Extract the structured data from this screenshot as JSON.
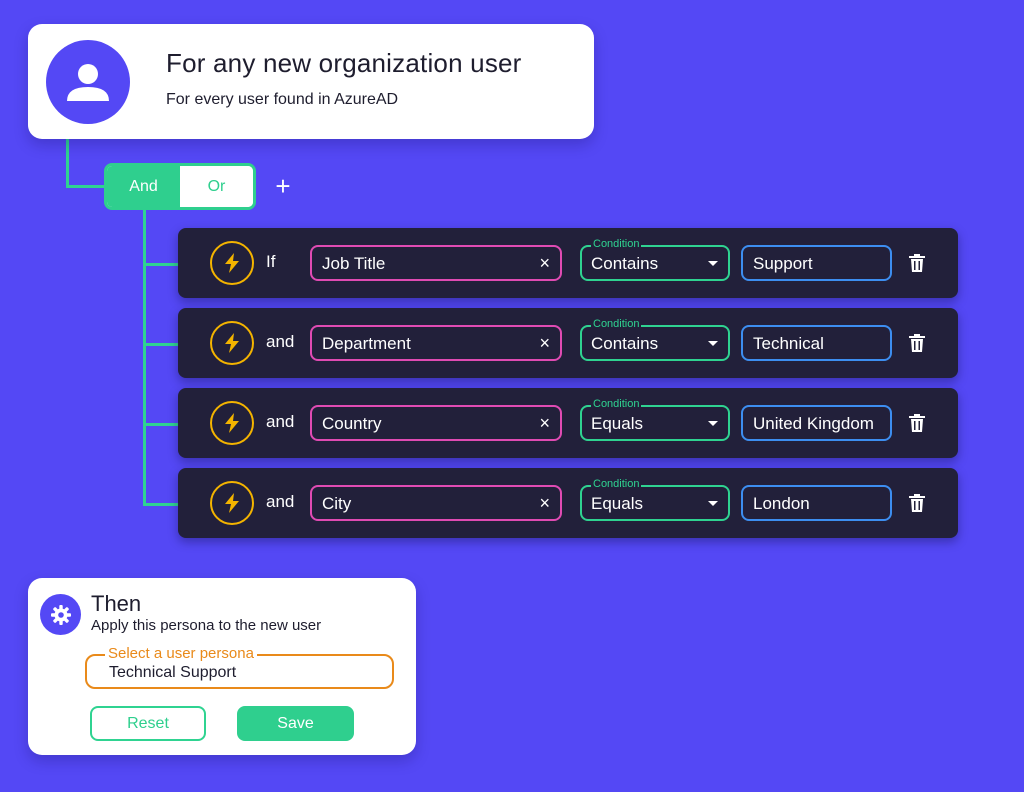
{
  "trigger": {
    "title": "For any new organization user",
    "subtitle": "For every user found in AzureAD",
    "icon": "user-icon"
  },
  "logic_toggle": {
    "options": [
      "And",
      "Or"
    ],
    "selected": "And"
  },
  "add_button_label": "+",
  "conditions": [
    {
      "conjunction": "If",
      "field": "Job Title",
      "condition_legend": "Condition",
      "operator": "Contains",
      "value": "Support"
    },
    {
      "conjunction": "and",
      "field": "Department",
      "condition_legend": "Condition",
      "operator": "Contains",
      "value": "Technical"
    },
    {
      "conjunction": "and",
      "field": "Country",
      "condition_legend": "Condition",
      "operator": "Equals",
      "value": "United Kingdom"
    },
    {
      "conjunction": "and",
      "field": "City",
      "condition_legend": "Condition",
      "operator": "Equals",
      "value": "London"
    }
  ],
  "clear_label": "×",
  "action": {
    "title": "Then",
    "subtitle": "Apply this persona to the new user",
    "persona_legend": "Select a user persona",
    "persona_value": "Technical Support",
    "reset_label": "Reset",
    "save_label": "Save",
    "icon": "gear-icon"
  },
  "colors": {
    "background": "#5448f5",
    "row_bg": "#22203a",
    "green": "#2fcf8e",
    "pink": "#e04bb3",
    "blue": "#3d8ef0",
    "amber": "#f4b400",
    "orange": "#e98a1a"
  }
}
